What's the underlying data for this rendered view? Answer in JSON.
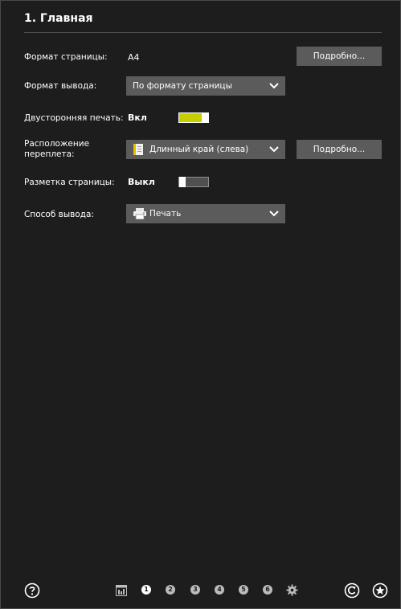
{
  "header": {
    "title": "1. Главная"
  },
  "settings": {
    "page_format": {
      "label": "Формат страницы:",
      "value": "A4",
      "details_label": "Подробно..."
    },
    "output_format": {
      "label": "Формат вывода:",
      "value": "По формату страницы",
      "icon": "chevron-down-icon"
    },
    "duplex": {
      "label": "Двусторонняя печать:",
      "value": "Вкл",
      "state": "on",
      "accent": "#c6d000"
    },
    "binding": {
      "label_line1": "Расположение",
      "label_line2": "переплета:",
      "value": "Длинный край (слева)",
      "icon": "page-binding-icon",
      "details_label": "Подробно..."
    },
    "layout": {
      "label": "Разметка страницы:",
      "value": "Выкл",
      "state": "off"
    },
    "output_method": {
      "label": "Способ вывода:",
      "value": "Печать",
      "icon": "printer-icon"
    }
  },
  "footer": {
    "help_icon": "help-icon",
    "steps": [
      "1",
      "2",
      "3",
      "4",
      "5",
      "6"
    ],
    "active_step": "1",
    "icons": [
      "page-preview-icon",
      "gear-icon",
      "reset-icon",
      "favorite-star-icon"
    ]
  }
}
